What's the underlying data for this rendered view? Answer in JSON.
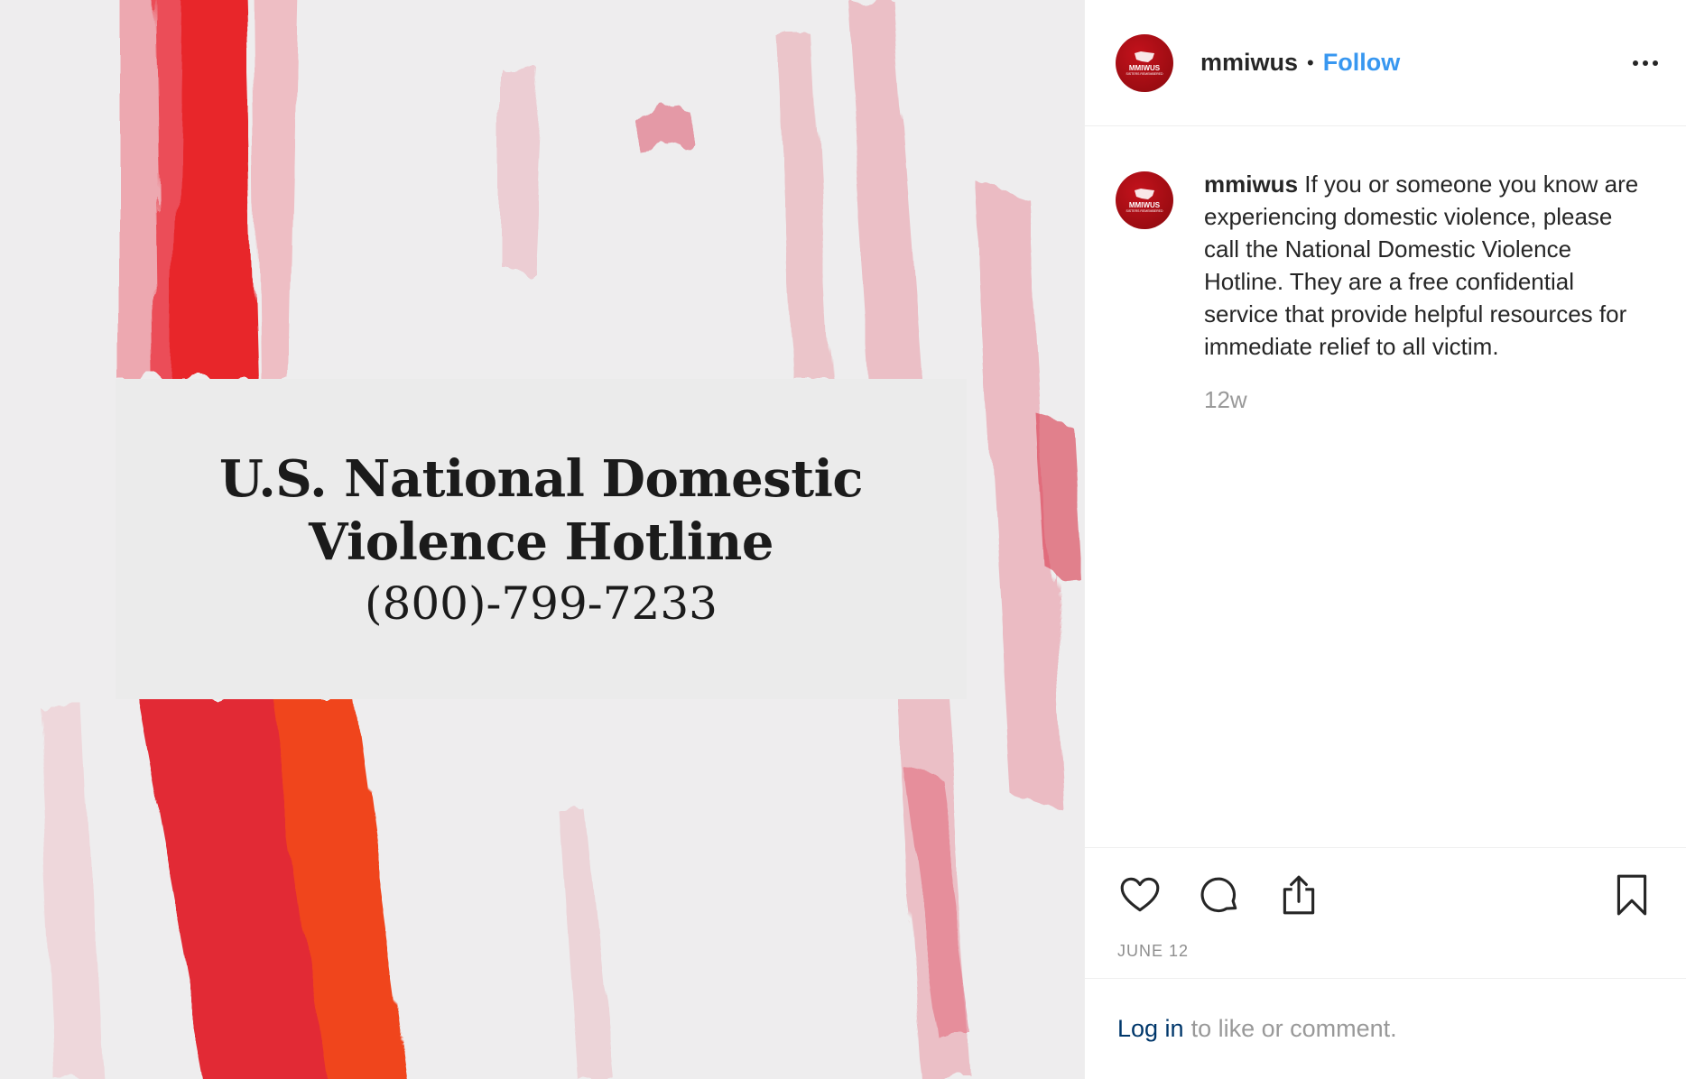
{
  "post_image": {
    "title": "U.S. National Domestic Violence Hotline",
    "phone": "(800)-799-7233"
  },
  "header": {
    "username": "mmiwus",
    "separator": "•",
    "follow_label": "Follow",
    "more_icon": "more-options-icon"
  },
  "avatar": {
    "brand_text": "MMIWUS",
    "sub_text": "SISTERS REMEMBERED",
    "color": "#a30e15"
  },
  "caption": {
    "username": "mmiwus",
    "text": "If you or someone you know are experiencing domestic violence, please call the National Domestic Violence Hotline. They are a free confidential service that provide helpful resources for immediate relief to all victim.",
    "time": "12w"
  },
  "actions": {
    "like_icon": "heart-icon",
    "comment_icon": "comment-icon",
    "share_icon": "share-icon",
    "save_icon": "bookmark-icon"
  },
  "date": "JUNE 12",
  "login": {
    "link": "Log in",
    "rest": "to like or comment."
  },
  "colors": {
    "accent": "#3897f0",
    "paint_red": "#e8242c"
  }
}
